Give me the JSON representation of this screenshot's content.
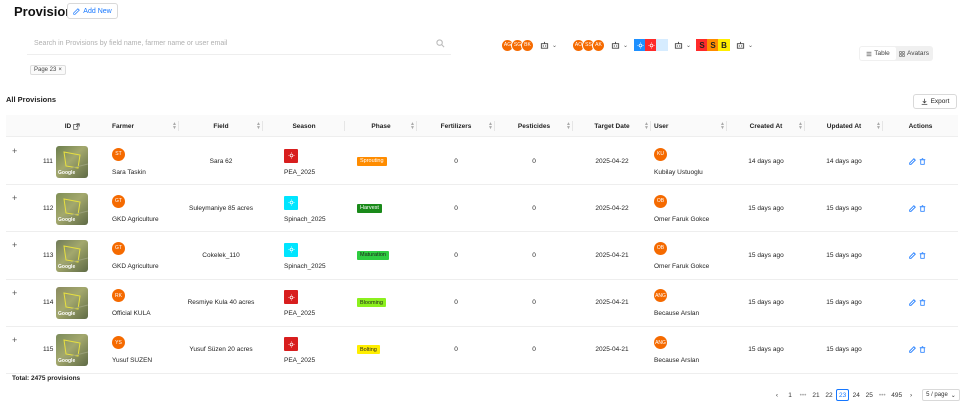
{
  "header": {
    "title": "Provisions",
    "add_new": "Add New"
  },
  "search": {
    "placeholder": "Search in Provisions by field name, farmer name or user email"
  },
  "filter_chip": {
    "label": "Page 23",
    "close": "×"
  },
  "avatar_filters": [
    {
      "avatars": [
        "AG",
        "SG",
        "BK"
      ]
    },
    {
      "avatars": [
        "AO",
        "SS",
        "AK"
      ]
    }
  ],
  "season_filter": {
    "squares": [
      {
        "text": "",
        "color": "#1e90ff"
      },
      {
        "text": "",
        "color": "#ff2a2a"
      },
      {
        "text": "",
        "color": "#d6ecff"
      }
    ]
  },
  "phase_filter": {
    "squares": [
      {
        "text": "S",
        "color": "#ff2a2a"
      },
      {
        "text": "S",
        "color": "#ff8c00"
      },
      {
        "text": "B",
        "color": "#ffee00"
      }
    ]
  },
  "view_toggle": {
    "table": "Table",
    "avatars": "Avatars"
  },
  "section": {
    "title": "All Provisions",
    "export": "Export"
  },
  "columns": [
    "ID",
    "Farmer",
    "Field",
    "Season",
    "Phase",
    "Fertilizers",
    "Pesticides",
    "Target Date",
    "User",
    "Created At",
    "Updated At",
    "Actions"
  ],
  "rows": [
    {
      "id": "111",
      "farmer_initials": "ST",
      "farmer": "Sara Taskin",
      "field": "Sara 62",
      "season_color": "#d81e1e",
      "season": "PEA_2025",
      "phase": "Sprouting",
      "phase_bg": "#ff8c00",
      "phase_fg": "#ffffff",
      "fertilizers": "0",
      "pesticides": "0",
      "target_date": "2025-04-22",
      "user_initials": "KU",
      "user": "Kubilay Ustuoglu",
      "created": "14 days ago",
      "updated": "14 days ago"
    },
    {
      "id": "112",
      "farmer_initials": "GT",
      "farmer": "GKD Agriculture",
      "field": "Suleymaniye 85 acres",
      "season_color": "#00e5ff",
      "season": "Spinach_2025",
      "phase": "Harvest",
      "phase_bg": "#1a8a1a",
      "phase_fg": "#ffffff",
      "fertilizers": "0",
      "pesticides": "0",
      "target_date": "2025-04-22",
      "user_initials": "OB",
      "user": "Omer Faruk Gokce",
      "created": "15 days ago",
      "updated": "15 days ago"
    },
    {
      "id": "113",
      "farmer_initials": "GT",
      "farmer": "GKD Agriculture",
      "field": "Cokelek_110",
      "season_color": "#00e5ff",
      "season": "Spinach_2025",
      "phase": "Maturation",
      "phase_bg": "#2ecc40",
      "phase_fg": "#1f1f1f",
      "fertilizers": "0",
      "pesticides": "0",
      "target_date": "2025-04-21",
      "user_initials": "OB",
      "user": "Omer Faruk Gokce",
      "created": "15 days ago",
      "updated": "15 days ago"
    },
    {
      "id": "114",
      "farmer_initials": "RK",
      "farmer": "Official KULA",
      "field": "Resmiye Kula 40 acres",
      "season_color": "#d81e1e",
      "season": "PEA_2025",
      "phase": "Blooming",
      "phase_bg": "#8cf01e",
      "phase_fg": "#1f1f1f",
      "fertilizers": "0",
      "pesticides": "0",
      "target_date": "2025-04-21",
      "user_initials": "ANG",
      "user": "Because Arslan",
      "created": "15 days ago",
      "updated": "15 days ago"
    },
    {
      "id": "115",
      "farmer_initials": "YS",
      "farmer": "Yusuf SUZEN",
      "field": "Yusuf Süzen 20 acres",
      "season_color": "#d81e1e",
      "season": "PEA_2025",
      "phase": "Bolting",
      "phase_bg": "#ffee00",
      "phase_fg": "#1f1f1f",
      "fertilizers": "0",
      "pesticides": "0",
      "target_date": "2025-04-21",
      "user_initials": "ANG",
      "user": "Because Arslan",
      "created": "15 days ago",
      "updated": "15 days ago"
    }
  ],
  "footer": {
    "total": "Total: 2475 provisions"
  },
  "pagination": {
    "pages": [
      "1",
      "•••",
      "21",
      "22",
      "23",
      "24",
      "25",
      "•••",
      "495"
    ],
    "active": "23",
    "page_size": "5 / page"
  }
}
